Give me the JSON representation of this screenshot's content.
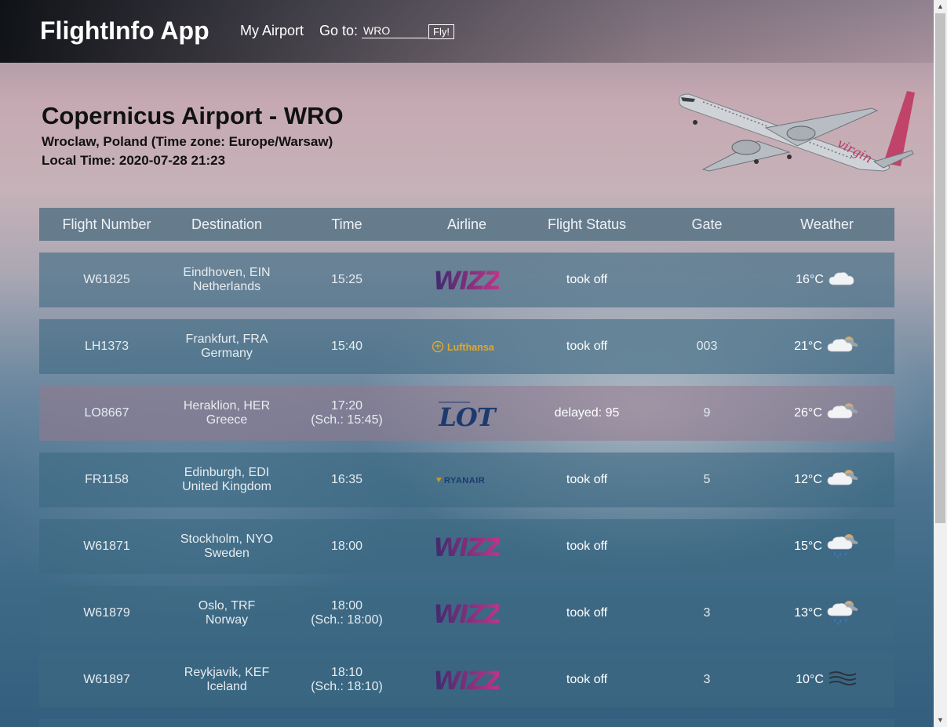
{
  "nav": {
    "brand": "FlightInfo App",
    "my_airport": "My Airport",
    "goto_label": "Go to:",
    "goto_value": "WRO",
    "fly_label": "Fly!"
  },
  "airport": {
    "title": "Copernicus Airport - WRO",
    "subtitle": "Wroclaw, Poland (Time zone: Europe/Warsaw)",
    "local_time": "Local Time: 2020-07-28 21:23"
  },
  "table": {
    "headers": [
      "Flight Number",
      "Destination",
      "Time",
      "Airline",
      "Flight Status",
      "Gate",
      "Weather"
    ],
    "rows": [
      {
        "flight": "W61825",
        "city": "Eindhoven, EIN",
        "country": "Netherlands",
        "time": "15:25",
        "sched": "",
        "airline": "wizz",
        "status": "took off",
        "gate": "",
        "temp": "16°C",
        "weather_icon": "cloud-icon"
      },
      {
        "flight": "LH1373",
        "city": "Frankfurt, FRA",
        "country": "Germany",
        "time": "15:40",
        "sched": "",
        "airline": "lufthansa",
        "status": "took off",
        "gate": "003",
        "temp": "21°C",
        "weather_icon": "partly-cloudy-icon"
      },
      {
        "flight": "LO8667",
        "city": "Heraklion, HER",
        "country": "Greece",
        "time": "17:20",
        "sched": "(Sch.: 15:45)",
        "airline": "lot",
        "status": "delayed: 95",
        "gate": "9",
        "temp": "26°C",
        "weather_icon": "partly-cloudy-icon"
      },
      {
        "flight": "FR1158",
        "city": "Edinburgh, EDI",
        "country": "United Kingdom",
        "time": "16:35",
        "sched": "",
        "airline": "ryanair",
        "status": "took off",
        "gate": "5",
        "temp": "12°C",
        "weather_icon": "partly-cloudy-icon"
      },
      {
        "flight": "W61871",
        "city": "Stockholm, NYO",
        "country": "Sweden",
        "time": "18:00",
        "sched": "",
        "airline": "wizz",
        "status": "took off",
        "gate": "",
        "temp": "15°C",
        "weather_icon": "rain-icon"
      },
      {
        "flight": "W61879",
        "city": "Oslo, TRF",
        "country": "Norway",
        "time": "18:00",
        "sched": "(Sch.: 18:00)",
        "airline": "wizz",
        "status": "took off",
        "gate": "3",
        "temp": "13°C",
        "weather_icon": "rain-icon"
      },
      {
        "flight": "W61897",
        "city": "Reykjavik, KEF",
        "country": "Iceland",
        "time": "18:10",
        "sched": "(Sch.: 18:10)",
        "airline": "wizz",
        "status": "took off",
        "gate": "3",
        "temp": "10°C",
        "weather_icon": "fog-icon"
      }
    ]
  },
  "logos": {
    "wizz": "WIZZ",
    "lufthansa": "Lufthansa",
    "lot": "LOT",
    "ryanair": "RYANAIR",
    "airline_on_plane": "virgin"
  },
  "colors": {
    "wizz_pink": "#c6358a",
    "wizz_purple": "#3c2a6e",
    "lufthansa_yellow": "#e0a82e",
    "lot_blue": "#1d3a6e",
    "ryanair_navy": "#1b3a6b"
  }
}
